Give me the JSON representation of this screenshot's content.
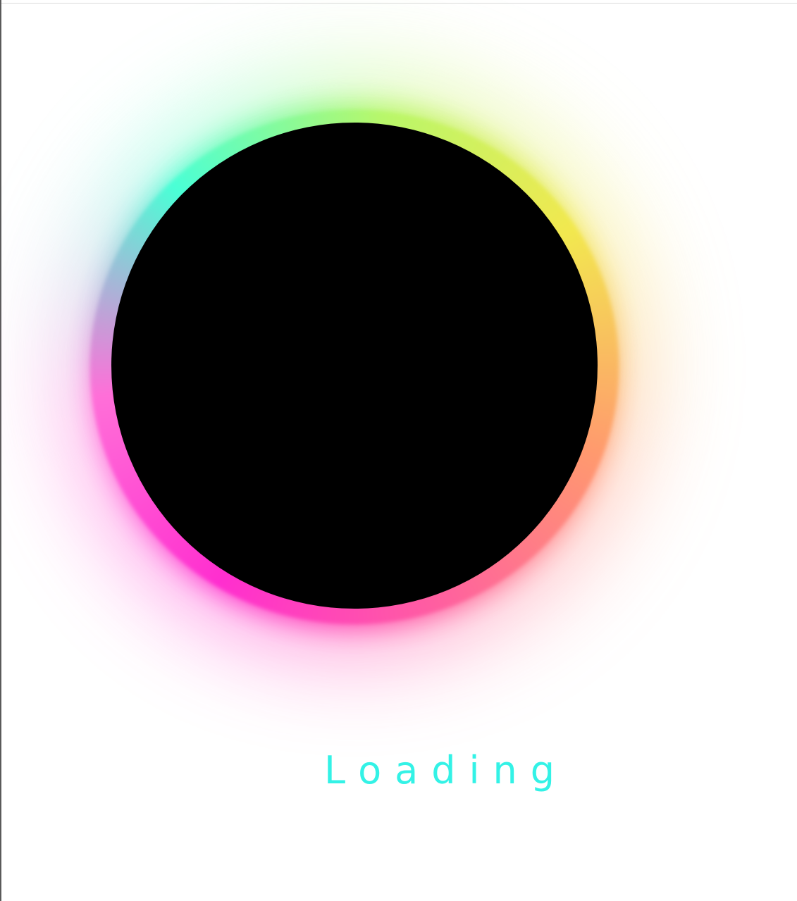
{
  "loader": {
    "text": "Loading",
    "text_color": "#33f2e6",
    "core_color": "#000000",
    "gradient_colors": [
      "#4affd6",
      "#b8f76a",
      "#f2e84f",
      "#ff9a6e",
      "#ff5fa0",
      "#ff2ecf",
      "#ff6fd8"
    ]
  }
}
